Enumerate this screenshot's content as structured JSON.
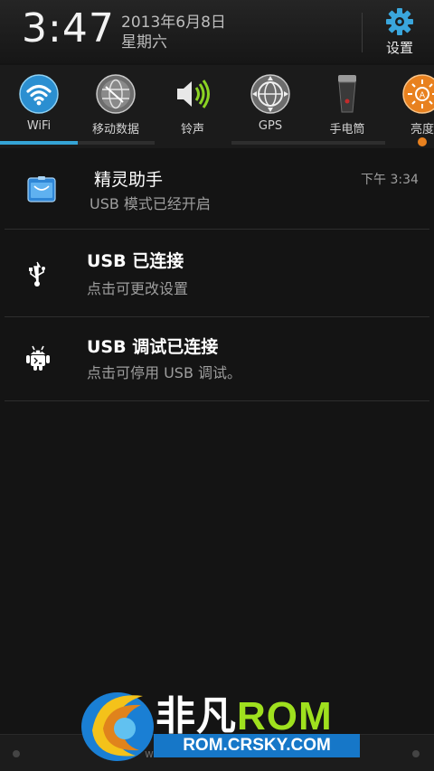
{
  "status": {
    "time": "3:47",
    "date": "2013年6月8日",
    "weekday": "星期六",
    "settings_label": "设置"
  },
  "toggles": [
    {
      "label": "WiFi",
      "icon": "wifi-icon",
      "active": true
    },
    {
      "label": "移动数据",
      "icon": "mobile-data-icon",
      "active": false
    },
    {
      "label": "铃声",
      "icon": "ringtone-icon",
      "active": true
    },
    {
      "label": "GPS",
      "icon": "gps-icon",
      "active": false
    },
    {
      "label": "手电筒",
      "icon": "flashlight-icon",
      "active": false
    },
    {
      "label": "亮度",
      "icon": "brightness-icon",
      "active": false
    }
  ],
  "notifications": [
    {
      "title": "精灵助手",
      "subtitle": "USB 模式已经开启",
      "time": "下午 3:34",
      "icon": "wizard-helper-icon"
    },
    {
      "title": "USB 已连接",
      "subtitle": "点击可更改设置",
      "icon": "usb-icon"
    },
    {
      "title": "USB 调试已连接",
      "subtitle": "点击可停用 USB 调试。",
      "icon": "android-debug-icon"
    }
  ],
  "watermark": {
    "brand_cn": "非凡",
    "brand_en": "ROM",
    "site": "ROM.CRSKY.COM",
    "url": "www.shendu.com"
  },
  "colors": {
    "accent": "#35a4d6",
    "brightness": "#e8811f",
    "brand_green": "#9fe01e",
    "brand_blue": "#1677c8"
  }
}
